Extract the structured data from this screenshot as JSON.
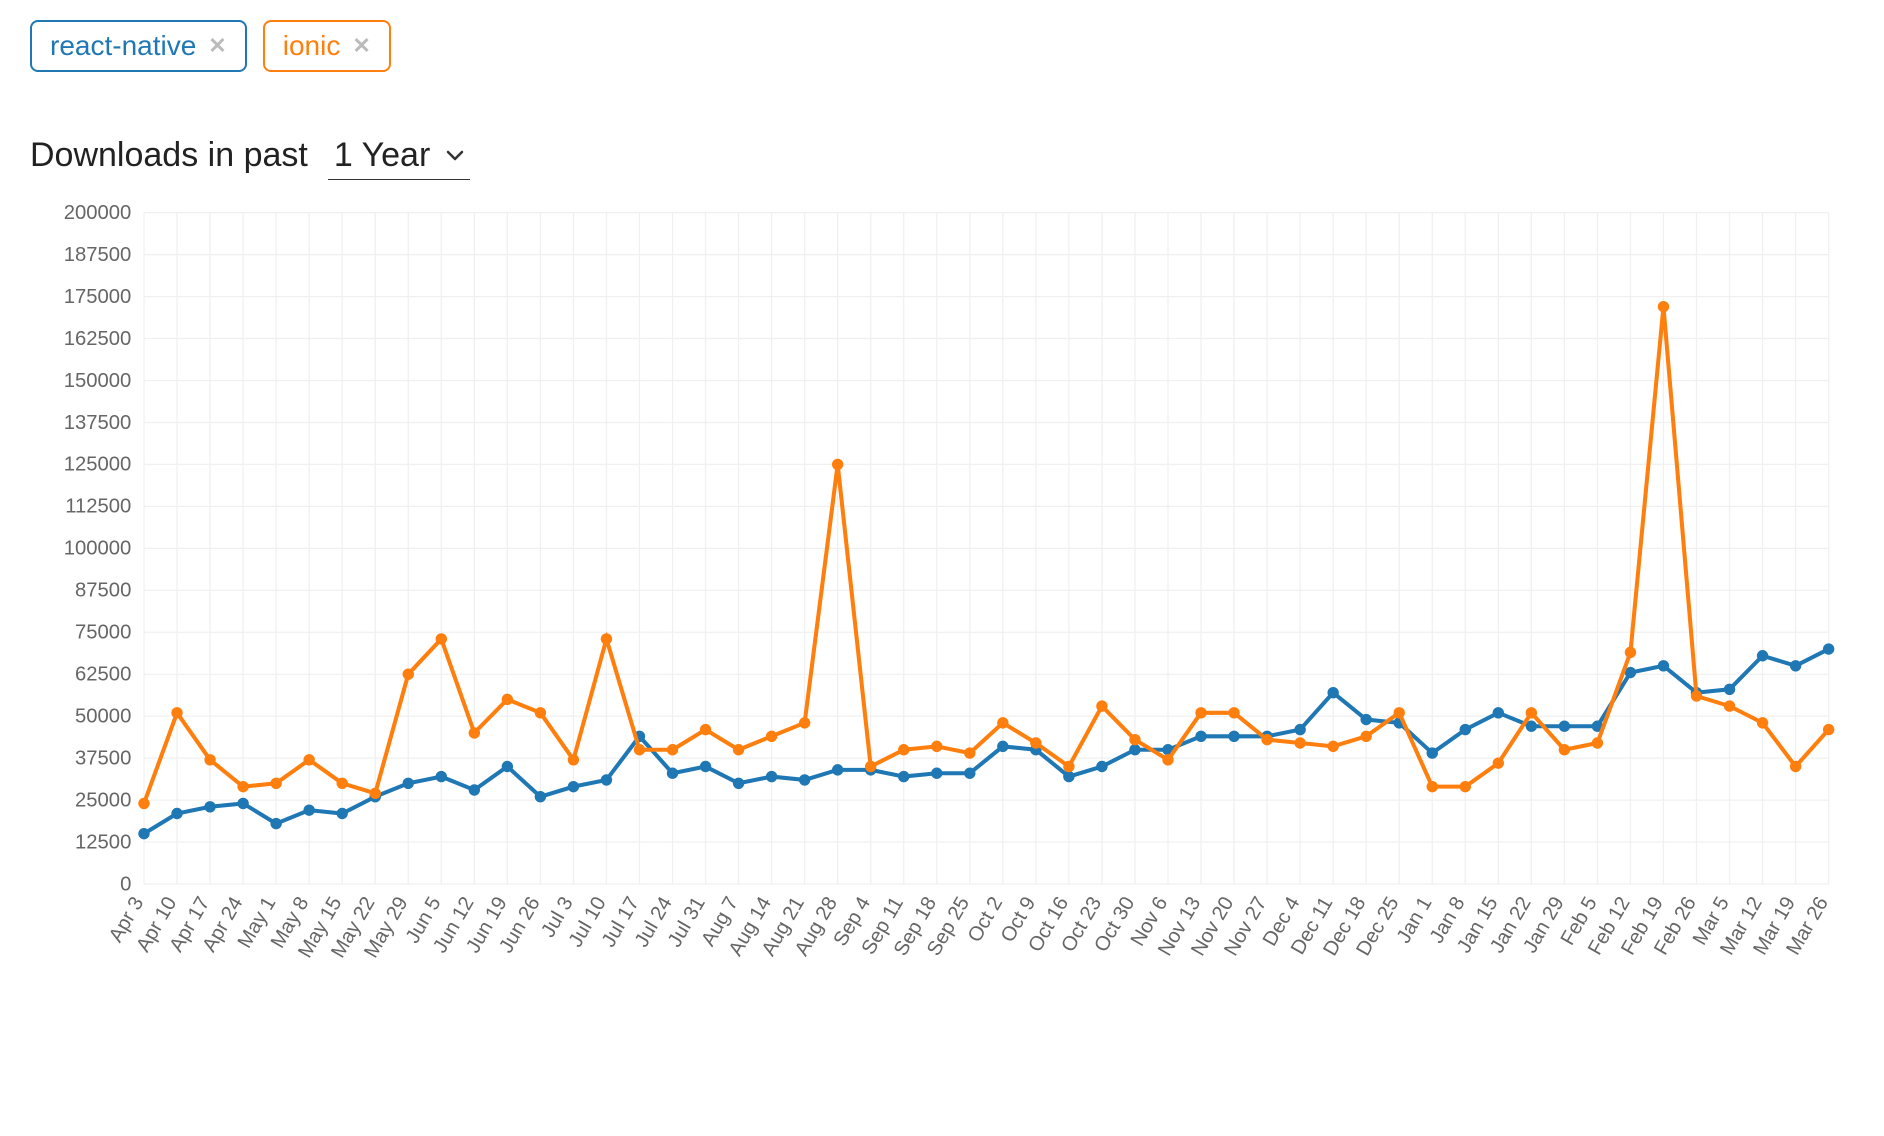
{
  "tags": [
    {
      "label": "react-native",
      "color": "#1f77b4",
      "key": "react_native"
    },
    {
      "label": "ionic",
      "color": "#ff7f0e",
      "key": "ionic"
    }
  ],
  "heading": {
    "prefix": "Downloads in past",
    "period_selected": "1 Year"
  },
  "chart_data": {
    "type": "line",
    "categories": [
      "Apr 3",
      "Apr 10",
      "Apr 17",
      "Apr 24",
      "May 1",
      "May 8",
      "May 15",
      "May 22",
      "May 29",
      "Jun 5",
      "Jun 12",
      "Jun 19",
      "Jun 26",
      "Jul 3",
      "Jul 10",
      "Jul 17",
      "Jul 24",
      "Jul 31",
      "Aug 7",
      "Aug 14",
      "Aug 21",
      "Aug 28",
      "Sep 4",
      "Sep 11",
      "Sep 18",
      "Sep 25",
      "Oct 2",
      "Oct 9",
      "Oct 16",
      "Oct 23",
      "Oct 30",
      "Nov 6",
      "Nov 13",
      "Nov 20",
      "Nov 27",
      "Dec 4",
      "Dec 11",
      "Dec 18",
      "Dec 25",
      "Jan 1",
      "Jan 8",
      "Jan 15",
      "Jan 22",
      "Jan 29",
      "Feb 5",
      "Feb 12",
      "Feb 19",
      "Feb 26",
      "Mar 5",
      "Mar 12",
      "Mar 19",
      "Mar 26"
    ],
    "series": [
      {
        "name": "react-native",
        "color": "#1f77b4",
        "values": [
          15000,
          21000,
          23000,
          24000,
          18000,
          22000,
          21000,
          26000,
          30000,
          32000,
          28000,
          35000,
          26000,
          29000,
          31000,
          44000,
          33000,
          35000,
          30000,
          32000,
          31000,
          34000,
          34000,
          32000,
          33000,
          33000,
          41000,
          40000,
          32000,
          35000,
          40000,
          40000,
          44000,
          44000,
          44000,
          46000,
          57000,
          49000,
          48000,
          39000,
          46000,
          51000,
          47000,
          47000,
          47000,
          63000,
          65000,
          57000,
          58000,
          68000,
          65000,
          70000
        ]
      },
      {
        "name": "ionic",
        "color": "#ff7f0e",
        "values": [
          24000,
          51000,
          37000,
          29000,
          30000,
          37000,
          30000,
          27000,
          62500,
          73000,
          45000,
          55000,
          51000,
          37000,
          73000,
          40000,
          40000,
          46000,
          40000,
          44000,
          48000,
          125000,
          35000,
          40000,
          41000,
          39000,
          48000,
          42000,
          35000,
          53000,
          43000,
          37000,
          51000,
          51000,
          43000,
          42000,
          41000,
          44000,
          51000,
          29000,
          29000,
          36000,
          51000,
          40000,
          42000,
          69000,
          172000,
          56000,
          53000,
          48000,
          35000,
          46000
        ]
      }
    ],
    "ylim": [
      0,
      200000
    ],
    "yticks": [
      0,
      12500,
      25000,
      37500,
      50000,
      62500,
      75000,
      87500,
      100000,
      112500,
      125000,
      137500,
      150000,
      162500,
      175000,
      187500,
      200000
    ],
    "title": "",
    "xlabel": "",
    "ylabel": ""
  }
}
